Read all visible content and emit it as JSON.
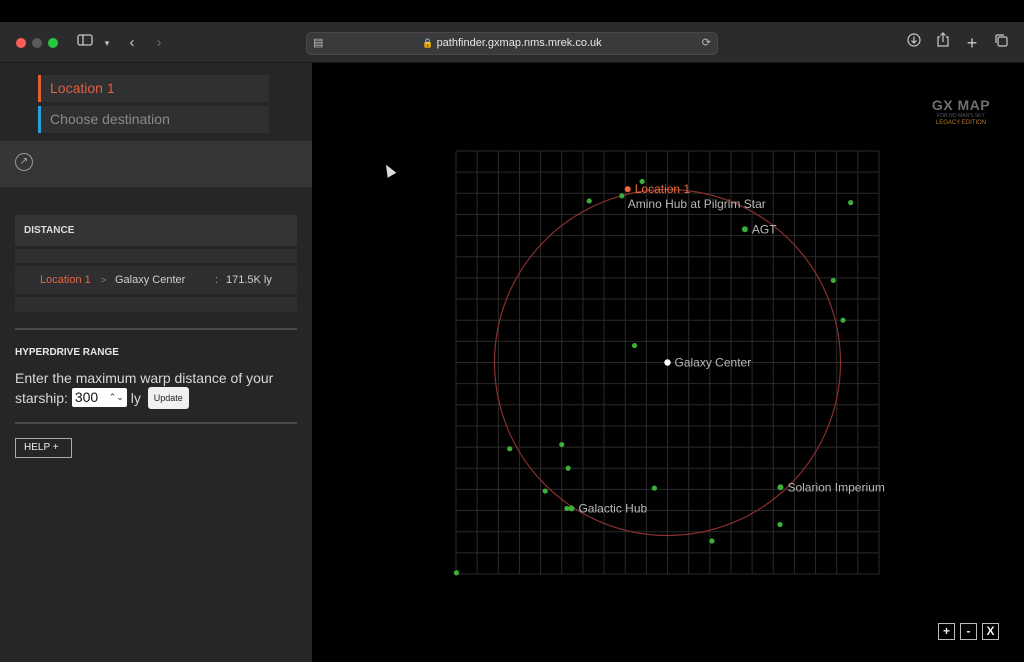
{
  "browser": {
    "url": "pathfinder.gxmap.nms.mrek.co.uk",
    "lock_icon": "lock-icon",
    "back_icon": "‹",
    "forward_icon": "›"
  },
  "route": {
    "origin": "Location 1",
    "destination_placeholder": "Choose destination"
  },
  "distance": {
    "heading": "DISTANCE",
    "from": "Location 1",
    "arrow": ">",
    "to": "Galaxy Center",
    "colon": ":",
    "value": "171.5K ly"
  },
  "hyperdrive": {
    "heading": "HYPERDRIVE RANGE",
    "text": "Enter the maximum warp distance of your starship:",
    "value": "300",
    "unit": "ly",
    "update_label": "Update"
  },
  "help_label": "HELP  +",
  "brand": {
    "title": "GX MAP",
    "subtitle": "FOR NO MAN'S SKY",
    "edition": "LEGACY EDITION"
  },
  "map": {
    "range": [
      0,
      10
    ],
    "center_label": "Galaxy Center",
    "colors": {
      "current": "#f06a3a",
      "hub": "#3cae3c",
      "center": "#ffffff",
      "ring": "#8a3030",
      "grid": "#2a2a2a"
    },
    "labels": [
      {
        "name": "Location 1",
        "x": 4.06,
        "y": 0.9,
        "kind": "current"
      },
      {
        "name": "Amino Hub at Pilgrim Star",
        "x": 4.06,
        "y": 1.25,
        "kind": "label-only"
      },
      {
        "name": "AGT",
        "x": 6.83,
        "y": 1.85,
        "kind": "hub"
      },
      {
        "name": "Galaxy Center",
        "x": 5.0,
        "y": 5.0,
        "kind": "center"
      },
      {
        "name": "Solarion Imperium",
        "x": 7.67,
        "y": 7.95,
        "kind": "hub"
      },
      {
        "name": "Galactic Hub",
        "x": 2.73,
        "y": 8.45,
        "kind": "hub"
      }
    ],
    "dots": [
      [
        4.4,
        0.72
      ],
      [
        3.15,
        1.18
      ],
      [
        3.92,
        1.06
      ],
      [
        9.33,
        1.22
      ],
      [
        8.92,
        3.06
      ],
      [
        9.15,
        4.0
      ],
      [
        4.22,
        4.6
      ],
      [
        2.5,
        6.94
      ],
      [
        1.27,
        7.04
      ],
      [
        2.65,
        7.5
      ],
      [
        2.11,
        8.04
      ],
      [
        4.69,
        7.97
      ],
      [
        2.62,
        8.45
      ],
      [
        7.66,
        8.83
      ],
      [
        6.05,
        9.22
      ],
      [
        0.01,
        9.97
      ]
    ],
    "ring_radius": 4.09,
    "zoom_in": "+",
    "zoom_out": "-",
    "close": "X"
  }
}
